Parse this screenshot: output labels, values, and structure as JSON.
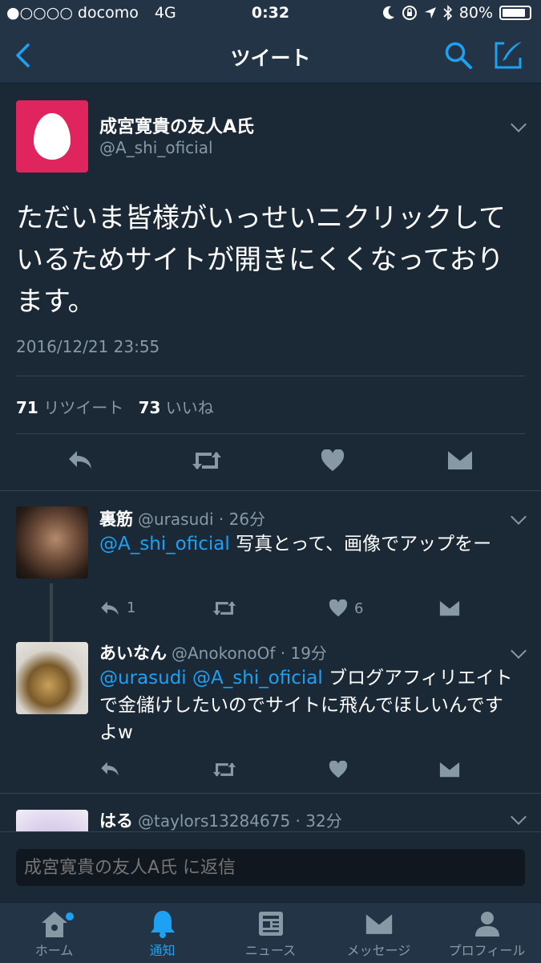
{
  "status_bar": {
    "carrier": "●○○○○ docomo",
    "network": "4G",
    "time": "0:32",
    "battery": "80%"
  },
  "nav": {
    "title": "ツイート",
    "back_icon": "chevron-left-icon",
    "search_icon": "search-icon",
    "compose_icon": "compose-icon"
  },
  "main_tweet": {
    "name": "成宮寛貴の友人A氏",
    "handle": "@A_shi_oficial",
    "text": "ただいま皆様がいっせいニクリックしているためサイトが開きにくくなっております。",
    "timestamp": "2016/12/21 23:55",
    "retweet_count": "71",
    "retweet_label": "リツイート",
    "like_count": "73",
    "like_label": "いいね"
  },
  "replies": [
    {
      "name": "裏筋",
      "handle": "@urasudi",
      "time": "· 26分",
      "mentions": "@A_shi_oficial",
      "text": " 写真とって、画像でアップをー",
      "reply_count": "1",
      "like_count": "6"
    },
    {
      "name": "あいなん",
      "handle": "@AnokonoOf",
      "time": "· 19分",
      "mentions": "@urasudi @A_shi_oficial",
      "text": " ブログアフィリエイトで金儲けしたいのでサイトに飛んでほしいんですよw",
      "reply_count": "",
      "like_count": ""
    },
    {
      "name": "はる",
      "handle": "@taylors13284675",
      "time": "· 32分"
    }
  ],
  "reply_box": {
    "placeholder": "成宮寛貴の友人A氏 に返信"
  },
  "tabs": [
    {
      "label": "ホーム",
      "icon": "home-icon"
    },
    {
      "label": "通知",
      "icon": "bell-icon"
    },
    {
      "label": "ニュース",
      "icon": "news-icon"
    },
    {
      "label": "メッセージ",
      "icon": "envelope-icon"
    },
    {
      "label": "プロフィール",
      "icon": "person-icon"
    }
  ],
  "colors": {
    "background": "#1b2836",
    "bar": "#243447",
    "accent": "#1da1f2",
    "muted": "#8899a6",
    "avatar_egg": "#e0245e"
  }
}
